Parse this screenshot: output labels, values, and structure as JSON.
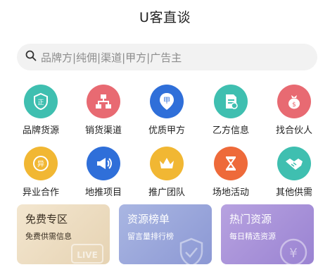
{
  "header": {
    "title": "U客直谈"
  },
  "search": {
    "placeholder": "品牌方|纯佣|渠道|甲方|广告主"
  },
  "grid": {
    "items": [
      {
        "label": "品牌货源",
        "icon": "shield-certified-icon",
        "color": "#3fbfb0"
      },
      {
        "label": "销货渠道",
        "icon": "hierarchy-icon",
        "color": "#e86a72"
      },
      {
        "label": "优质甲方",
        "icon": "map-pin-icon",
        "color": "#2f6fd9"
      },
      {
        "label": "乙方信息",
        "icon": "document-icon",
        "color": "#3fbfb0"
      },
      {
        "label": "找合伙人",
        "icon": "money-bag-icon",
        "color": "#e86a72"
      },
      {
        "label": "异业合作",
        "icon": "cooperation-badge-icon",
        "color": "#f1b733"
      },
      {
        "label": "地推项目",
        "icon": "megaphone-icon",
        "color": "#2f6fd9"
      },
      {
        "label": "推广团队",
        "icon": "crown-icon",
        "color": "#f1b733"
      },
      {
        "label": "场地活动",
        "icon": "hourglass-icon",
        "color": "#ee6a3a"
      },
      {
        "label": "其他供需",
        "icon": "handshake-icon",
        "color": "#3fbfb0"
      }
    ]
  },
  "cards": [
    {
      "title": "免费专区",
      "subtitle": "免费供需信息",
      "deco": "LIVE"
    },
    {
      "title": "资源榜单",
      "subtitle": "留言量排行榜",
      "deco": "check-shield-icon"
    },
    {
      "title": "热门资源",
      "subtitle": "每日精选资源",
      "deco": "¥"
    }
  ]
}
